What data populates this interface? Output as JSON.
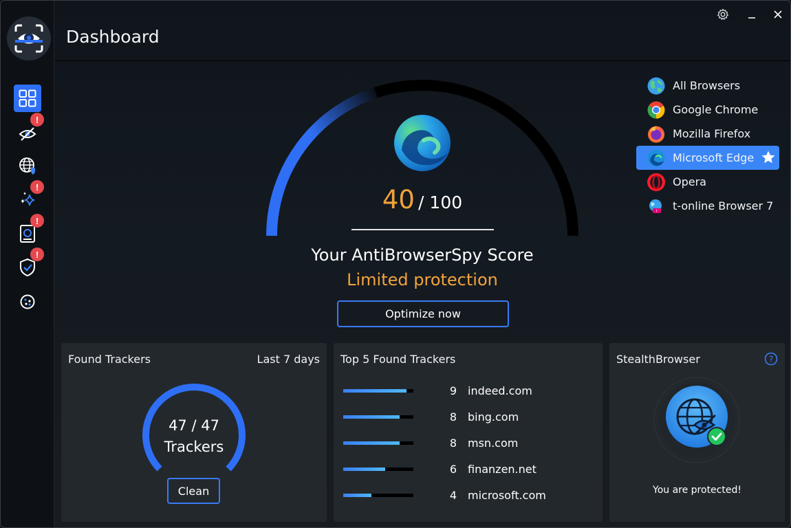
{
  "header": {
    "title": "Dashboard"
  },
  "score": {
    "value": "40",
    "max": "/ 100",
    "value_fraction": 0.4,
    "title": "Your AntiBrowserSpy Score",
    "status": "Limited protection",
    "optimize_label": "Optimize now"
  },
  "browsers": [
    {
      "label": "All Browsers",
      "icon": "globe-icon",
      "active": false
    },
    {
      "label": "Google Chrome",
      "icon": "chrome-icon",
      "active": false
    },
    {
      "label": "Mozilla Firefox",
      "icon": "firefox-icon",
      "active": false
    },
    {
      "label": "Microsoft Edge",
      "icon": "edge-icon",
      "active": true
    },
    {
      "label": "Opera",
      "icon": "opera-icon",
      "active": false
    },
    {
      "label": "t-online Browser 7",
      "icon": "t-online-icon",
      "active": false
    }
  ],
  "sidebar": {
    "items": [
      {
        "name": "dashboard",
        "icon": "grid-icon",
        "alert": false
      },
      {
        "name": "privacy",
        "icon": "eye-icon",
        "alert": true
      },
      {
        "name": "web",
        "icon": "globe-shield-icon",
        "alert": false
      },
      {
        "name": "cleaner",
        "icon": "sparkle-icon",
        "alert": true
      },
      {
        "name": "identity",
        "icon": "id-card-icon",
        "alert": true
      },
      {
        "name": "protection",
        "icon": "shield-check-icon",
        "alert": true
      },
      {
        "name": "cookies",
        "icon": "cookie-icon",
        "alert": false
      }
    ],
    "alert_glyph": "!"
  },
  "found_trackers": {
    "title": "Found Trackers",
    "period": "Last 7 days",
    "count": "47 / 47",
    "unit": "Trackers",
    "clean_label": "Clean"
  },
  "top_trackers": {
    "title": "Top 5 Found Trackers",
    "max": 10,
    "items": [
      {
        "count": "9",
        "domain": "indeed.com"
      },
      {
        "count": "8",
        "domain": "bing.com"
      },
      {
        "count": "8",
        "domain": "msn.com"
      },
      {
        "count": "6",
        "domain": "finanzen.net"
      },
      {
        "count": "4",
        "domain": "microsoft.com"
      }
    ]
  },
  "stealth": {
    "title": "StealthBrowser",
    "status": "You are protected!"
  },
  "colors": {
    "accent": "#2f6ff5",
    "warning": "#f2a33a",
    "alert": "#e5484d",
    "success": "#22c55e"
  }
}
